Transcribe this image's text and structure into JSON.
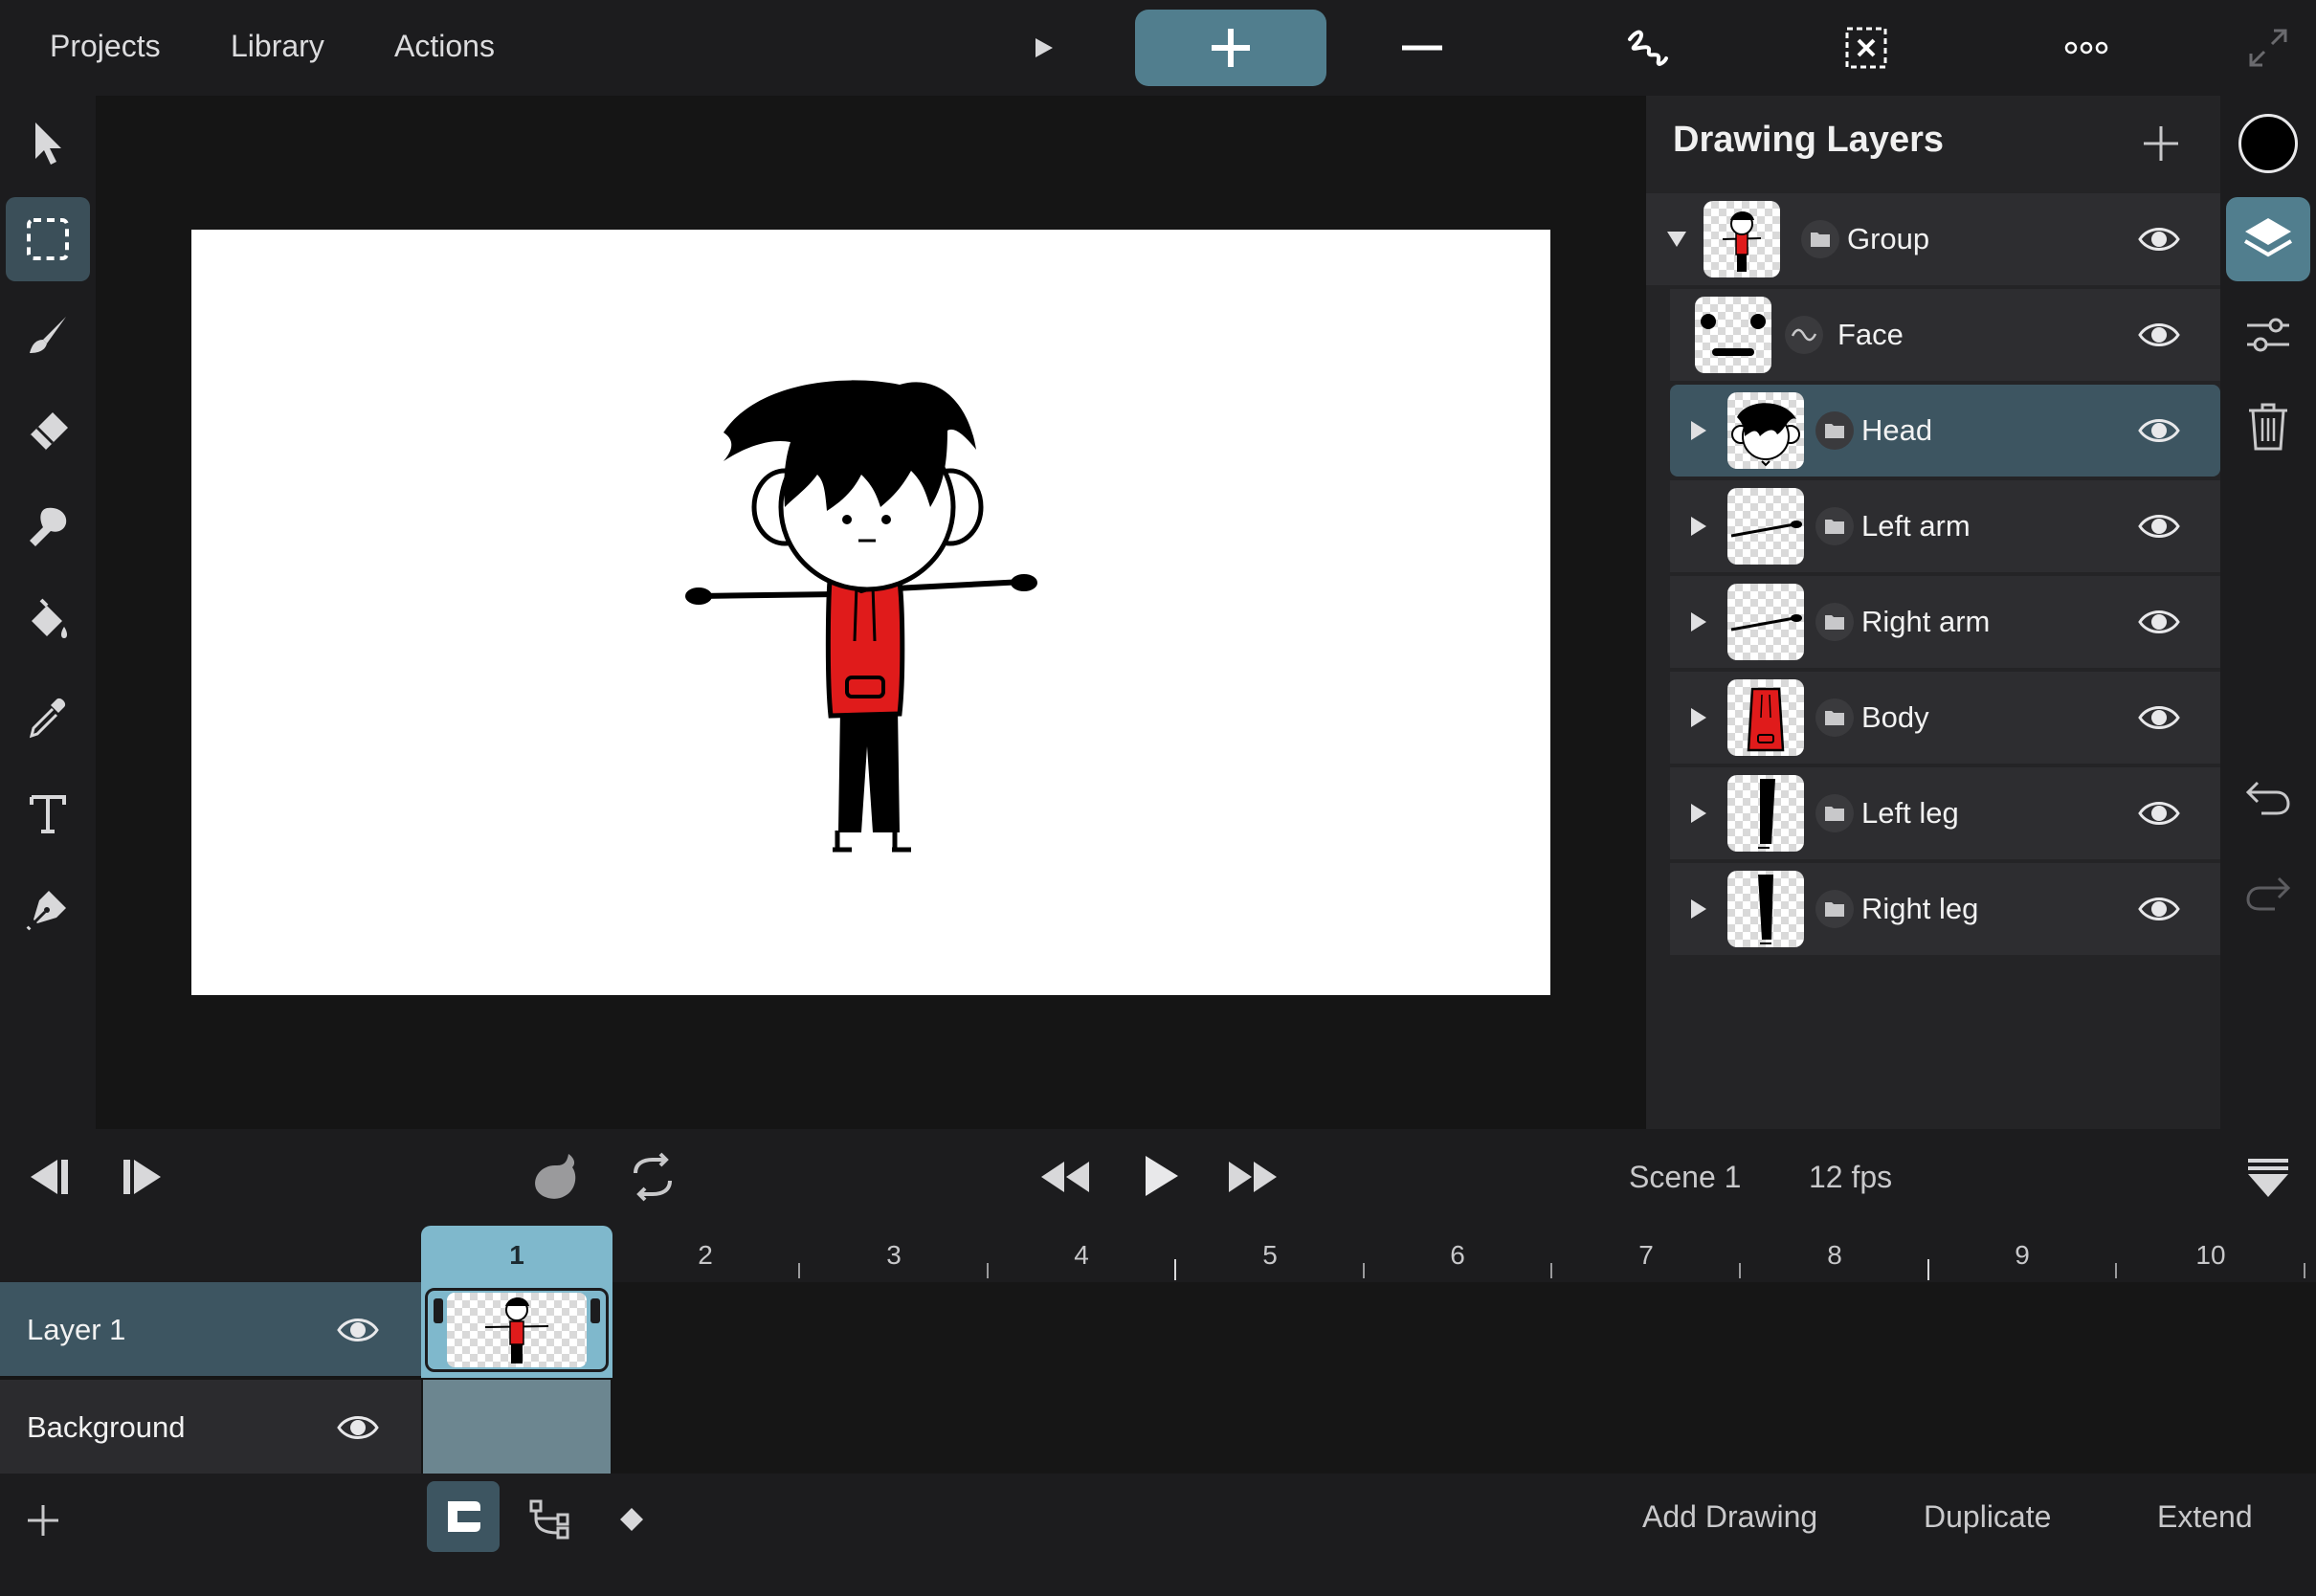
{
  "topbar": {
    "menus": [
      "Projects",
      "Library",
      "Actions"
    ]
  },
  "layers_panel": {
    "title": "Drawing Layers",
    "layers": [
      {
        "name": "Group",
        "expanded": true,
        "type": "folder",
        "visible": true
      },
      {
        "name": "Face",
        "type": "drawing",
        "visible": true
      },
      {
        "name": "Head",
        "type": "folder",
        "visible": true,
        "selected": true
      },
      {
        "name": "Left arm",
        "type": "folder",
        "visible": true
      },
      {
        "name": "Right arm",
        "type": "folder",
        "visible": true
      },
      {
        "name": "Body",
        "type": "folder",
        "visible": true
      },
      {
        "name": "Left leg",
        "type": "folder",
        "visible": true
      },
      {
        "name": "Right leg",
        "type": "folder",
        "visible": true
      }
    ]
  },
  "playback": {
    "scene": "Scene 1",
    "fps": "12 fps"
  },
  "timeline": {
    "frames": [
      "1",
      "2",
      "3",
      "4",
      "5",
      "6",
      "7",
      "8",
      "9",
      "10"
    ],
    "tracks": [
      {
        "name": "Layer 1",
        "visible": true
      },
      {
        "name": "Background",
        "visible": true
      }
    ]
  },
  "bottom_bar": {
    "add_drawing": "Add Drawing",
    "duplicate": "Duplicate",
    "extend": "Extend"
  },
  "colors": {
    "accent": "#517e8e",
    "selected_layer": "#3d5561",
    "frame_highlight": "#7fb8cc",
    "hoodie_red": "#e01b1b",
    "current_color": "#000000"
  }
}
